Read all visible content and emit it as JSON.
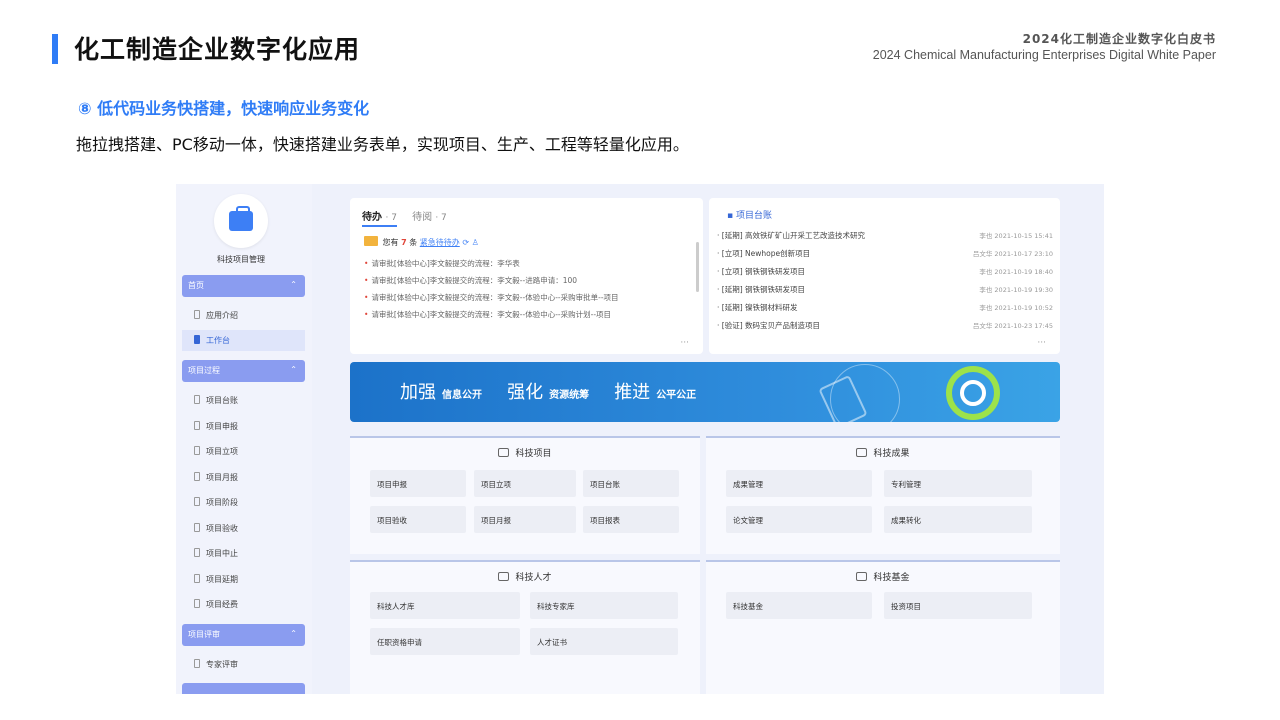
{
  "header": {
    "page_title": "化工制造企业数字化应用",
    "report_cn": "2024化工制造企业数字化白皮书",
    "report_en": "2024 Chemical Manufacturing Enterprises Digital White Paper"
  },
  "section": {
    "heading": "⑧ 低代码业务快搭建，快速响应业务变化",
    "body": "拖拉拽搭建、PC移动一体，快速搭建业务表单，实现项目、生产、工程等轻量化应用。"
  },
  "app": {
    "name": "科技项目管理",
    "sidebar": {
      "group_home": "首页",
      "item_intro": "应用介绍",
      "item_workbench": "工作台",
      "group_process": "项目过程",
      "process_items": [
        "项目台账",
        "项目申报",
        "项目立项",
        "项目月报",
        "项目阶段",
        "项目验收",
        "项目中止",
        "项目延期",
        "项目经费"
      ],
      "group_review": "项目评审",
      "item_expert": "专家评审"
    },
    "todo": {
      "tab_todo": "待办",
      "tab_todo_count": "· 7",
      "tab_done": "待阅",
      "tab_done_count": "· 7",
      "summary_prefix": "您有",
      "summary_count": "7",
      "summary_suffix": "条",
      "summary_link": "紧急待待办",
      "rows": [
        "请审批[体验中心]李文毅提交的流程：李华表",
        "请审批[体验中心]李文毅提交的流程：李文毅--进路申请：100",
        "请审批[体验中心]李文毅提交的流程：李文毅--体验中心--采购审批单--项目",
        "请审批[体验中心]李文毅提交的流程：李文毅--体验中心--采购计划--项目"
      ],
      "more": "···"
    },
    "projects": {
      "title": "项目台账",
      "rows": [
        {
          "name": "· [延期] 高效铁矿矿山开采工艺改造技术研究",
          "meta": "李也  2021-10-15 15:41"
        },
        {
          "name": "· [立项] Newhope创新项目",
          "meta": "吕文华  2021-10-17 23:10"
        },
        {
          "name": "· [立项] 钢铁钢铁研发项目",
          "meta": "李也  2021-10-19 18:40"
        },
        {
          "name": "· [延期] 钢铁钢铁研发项目",
          "meta": "李也  2021-10-19 19:30"
        },
        {
          "name": "· [延期] 镍铁钢材料研发",
          "meta": "李也  2021-10-19 10:52"
        },
        {
          "name": "· [验证] 数码宝贝产品制造项目",
          "meta": "吕文华  2021-10-23 17:45"
        }
      ],
      "more": "···"
    },
    "banner": {
      "big1": "加强",
      "small1": "信息公开",
      "big2": "强化",
      "small2": "资源统筹",
      "big3": "推进",
      "small3": "公平公正"
    },
    "panels": {
      "tech_projects": {
        "title": "科技项目",
        "buttons": [
          "项目申报",
          "项目立项",
          "项目台账",
          "项目验收",
          "项目月报",
          "项目报表"
        ]
      },
      "tech_results": {
        "title": "科技成果",
        "buttons": [
          "成果管理",
          "专利管理",
          "论文管理",
          "成果转化"
        ]
      },
      "tech_talent": {
        "title": "科技人才",
        "buttons": [
          "科技人才库",
          "科技专家库",
          "任职资格申请",
          "人才证书"
        ]
      },
      "tech_fund": {
        "title": "科技基金",
        "buttons": [
          "科技基金",
          "投资项目"
        ]
      }
    }
  }
}
